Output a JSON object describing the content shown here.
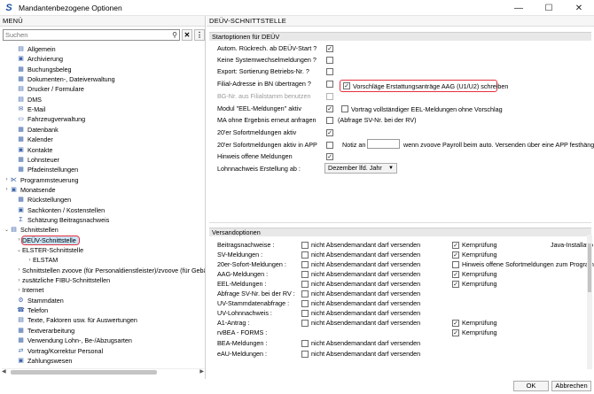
{
  "window": {
    "title": "Mandantenbezogene Optionen"
  },
  "menu": {
    "header": "MENÜ",
    "search_placeholder": "Suchen",
    "tree": [
      {
        "label": "Allgemein"
      },
      {
        "label": "Archivierung"
      },
      {
        "label": "Buchungsbeleg"
      },
      {
        "label": "Dokumenten-, Dateiverwaltung"
      },
      {
        "label": "Drucker / Formulare"
      },
      {
        "label": "DMS"
      },
      {
        "label": "E-Mail"
      },
      {
        "label": "Fahrzeugverwaltung"
      },
      {
        "label": "Datenbank"
      },
      {
        "label": "Kalender"
      },
      {
        "label": "Kontakte"
      },
      {
        "label": "Lohnsteuer"
      },
      {
        "label": "Pfadeinstellungen"
      },
      {
        "label": "Programmsteuerung"
      },
      {
        "label": "Monatsende"
      },
      {
        "label": "Rückstellungen"
      },
      {
        "label": "Sachkonten / Kostenstellen"
      },
      {
        "label": "Schätzung Beitragsnachweis"
      },
      {
        "label": "Schnittstellen"
      },
      {
        "label": "DEÜV-Schnittstelle"
      },
      {
        "label": "ELSTER-Schnittstelle"
      },
      {
        "label": "ELSTAM"
      },
      {
        "label": "Schnittstellen zvoove (für Personaldienstleister)/zvoove (für Gebä"
      },
      {
        "label": "zusätzliche FIBU-Schnittstellen"
      },
      {
        "label": "Internet"
      },
      {
        "label": "Stammdaten"
      },
      {
        "label": "Telefon"
      },
      {
        "label": "Texte, Faktoren usw. für Auswertungen"
      },
      {
        "label": "Textverarbeitung"
      },
      {
        "label": "Verwendung Lohn-, Be-/Abzugsarten"
      },
      {
        "label": "Vortrag/Korrektur Personal"
      },
      {
        "label": "Zahlungswesen"
      }
    ]
  },
  "right": {
    "header": "DEÜV-SCHNITTSTELLE",
    "start": {
      "title": "Startoptionen für DEÜV",
      "rows": [
        {
          "label": "Autom. Rückrech. ab DEÜV-Start ?"
        },
        {
          "label": "Keine Systemwechselmeldungen ?"
        },
        {
          "label": "Export: Sortierung Betriebs-Nr. ?"
        },
        {
          "label": "Filial-Adresse in BN übertragen ?"
        },
        {
          "label": "BG-Nr. aus Filialstamm benutzen"
        },
        {
          "label": "Modul \"EEL-Meldungen\" aktiv"
        },
        {
          "label": "MA ohne Ergebnis erneut anfragen"
        },
        {
          "label": "20'er Sofortmeldungen aktiv"
        },
        {
          "label": "20'er Sofortmeldungen aktiv in APP"
        },
        {
          "label": "Hinweis offene Meldungen"
        },
        {
          "label": "Lohnnachweis Erstellung ab :"
        }
      ],
      "extra_aag": "Vorschläge Erstattungsanträge AAG (U1/U2) schreiben",
      "extra_eel": "Vortrag vollständiger EEL-Meldungen ohne Vorschlag",
      "abfrage": "(Abfrage SV-Nr. bei der RV)",
      "notiz_an": "Notiz an",
      "notiz_text": "wenn zvoove Payroll beim auto. Versenden über eine APP festhängt",
      "lohnnachweis_value": "Dezember lfd. Jahr"
    },
    "versand": {
      "title": "Versandoptionen",
      "rows": [
        {
          "label": "Beitragsnachweise :"
        },
        {
          "label": "SV-Meldungen :"
        },
        {
          "label": "20er-Sofort-Meldungen :"
        },
        {
          "label": "AAG-Meldungen :"
        },
        {
          "label": "EEL-Meldungen :"
        },
        {
          "label": "Abfrage SV-Nr. bei der RV :"
        },
        {
          "label": "UV-Stammdatenabfrage :"
        },
        {
          "label": "UV-Lohnnachweis :"
        },
        {
          "label": "A1-Antrag :"
        },
        {
          "label": "rvBEA - FORMS :"
        },
        {
          "label": "BEA-Meldungen :"
        },
        {
          "label": "eAU-Meldungen :"
        }
      ],
      "absender": "nicht Absendemandant darf versenden",
      "kern": "Kernprüfung",
      "java": "Java-Installatio",
      "hinweis": "Hinweis offene Sofortmeldungen zum Programm"
    }
  },
  "footer": {
    "ok": "OK",
    "cancel": "Abbrechen"
  }
}
